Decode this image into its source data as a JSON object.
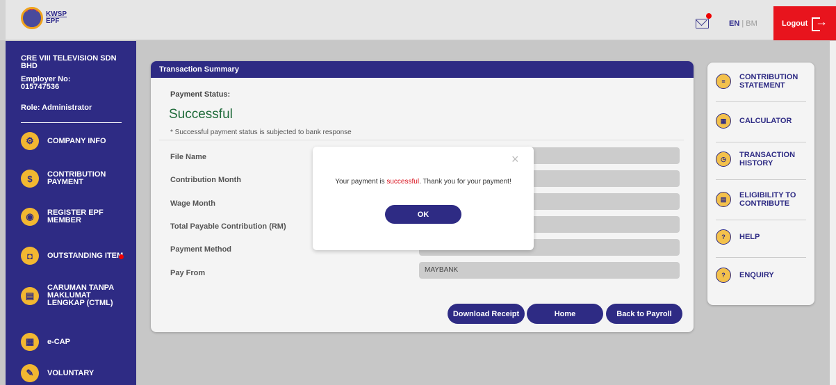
{
  "header": {
    "logo_top": "KWSP",
    "logo_bottom": "EPF",
    "lang_en": "EN",
    "lang_sep": "|",
    "lang_bm": "BM",
    "logout": "Logout"
  },
  "sidebar": {
    "company": "CRE VIII TELEVISION SDN BHD",
    "employer_label": "Employer No:",
    "employer_no": "015747536",
    "role": "Role: Administrator",
    "items": [
      {
        "label": "COMPANY INFO"
      },
      {
        "label": "CONTRIBUTION PAYMENT"
      },
      {
        "label": "REGISTER EPF MEMBER"
      },
      {
        "label": "OUTSTANDING ITEM"
      },
      {
        "label": "CARUMAN TANPA MAKLUMAT LENGKAP (CTML)"
      },
      {
        "label": "e-CAP"
      },
      {
        "label": "VOLUNTARY"
      }
    ]
  },
  "summary": {
    "title": "Transaction Summary",
    "status_label": "Payment Status:",
    "status_value": "Successful",
    "status_note": "* Successful payment status is subjected to bank response",
    "rows": [
      {
        "label": "File Name",
        "value": ""
      },
      {
        "label": "Contribution Month",
        "value": ""
      },
      {
        "label": "Wage Month",
        "value": ""
      },
      {
        "label": "Total Payable Contribution (RM)",
        "value": ""
      },
      {
        "label": "Payment Method",
        "value": ""
      },
      {
        "label": "Pay From",
        "value": "MAYBANK"
      }
    ],
    "buttons": {
      "download": "Download Receipt",
      "home": "Home",
      "back": "Back to Payroll"
    }
  },
  "right_panel": {
    "items": [
      {
        "label": "CONTRIBUTION STATEMENT",
        "icon": "statement-icon"
      },
      {
        "label": "CALCULATOR",
        "icon": "calculator-icon"
      },
      {
        "label": "TRANSACTION HISTORY",
        "icon": "history-icon"
      },
      {
        "label": "ELIGIBILITY TO CONTRIBUTE",
        "icon": "eligibility-icon"
      },
      {
        "label": "HELP",
        "icon": "help-icon"
      },
      {
        "label": "ENQUIRY",
        "icon": "enquiry-icon"
      }
    ]
  },
  "modal": {
    "msg_prefix": "Your payment is ",
    "msg_highlight": "successful",
    "msg_suffix": ". Thank you for your payment!",
    "ok": "OK",
    "close": "×"
  }
}
